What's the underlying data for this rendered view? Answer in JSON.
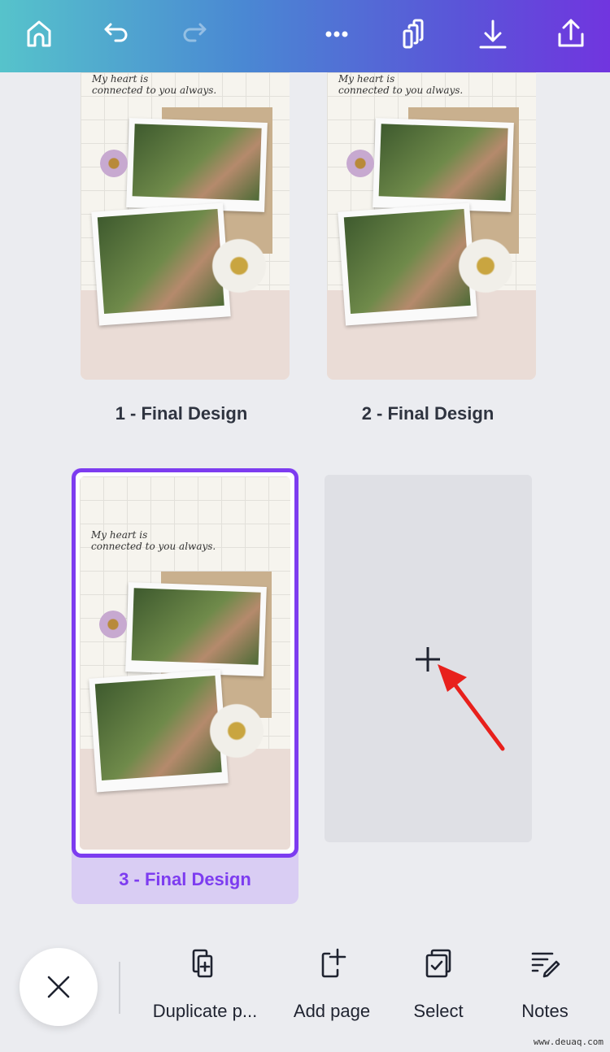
{
  "toolbar": {
    "icons": [
      "home-icon",
      "undo-icon",
      "redo-icon",
      "more-icon",
      "pages-icon",
      "download-icon",
      "share-icon"
    ],
    "redo_enabled": false
  },
  "pages": [
    {
      "label": "1 - Final Design",
      "selected": false
    },
    {
      "label": "2 - Final Design",
      "selected": false
    },
    {
      "label": "3 - Final Design",
      "selected": true
    }
  ],
  "design_text": {
    "line1": "My heart is",
    "line2": "connected to you always."
  },
  "add_page_tile": {
    "icon": "plus-icon"
  },
  "bottom_bar": {
    "close_icon": "close-icon",
    "actions": [
      {
        "label": "Duplicate p...",
        "icon": "duplicate-icon"
      },
      {
        "label": "Add page",
        "icon": "add-page-icon"
      },
      {
        "label": "Select",
        "icon": "select-icon"
      },
      {
        "label": "Notes",
        "icon": "notes-icon"
      }
    ]
  },
  "watermark": "www.deuaq.com",
  "colors": {
    "accent": "#7d3cf0",
    "selected_bg": "#d9cdf3",
    "annotation_arrow": "#e8201c"
  }
}
